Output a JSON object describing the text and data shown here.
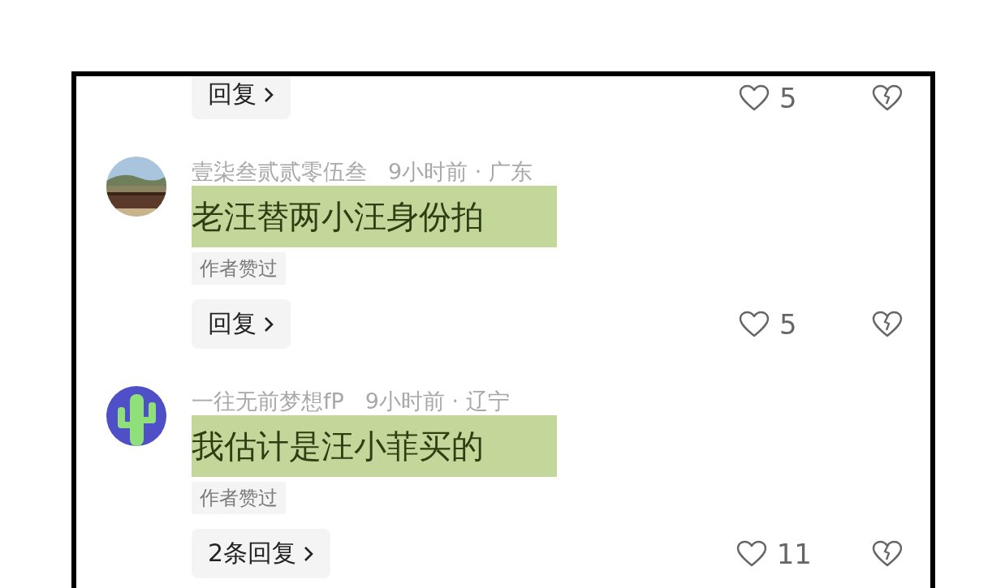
{
  "comments": [
    {
      "reply_label": "回复",
      "likes": "5"
    },
    {
      "author": "壹柒叁贰贰零伍叁",
      "meta": "9小时前 · 广东",
      "text": "老汪替两小汪身份拍",
      "highlighted": true,
      "badge": "作者赞过",
      "reply_label": "回复",
      "likes": "5"
    },
    {
      "author": "一往无前梦想fP",
      "meta": "9小时前 · 辽宁",
      "text": "我估计是汪小菲买的",
      "highlighted": true,
      "badge": "作者赞过",
      "reply_label": "2条回复",
      "likes": "11"
    }
  ]
}
